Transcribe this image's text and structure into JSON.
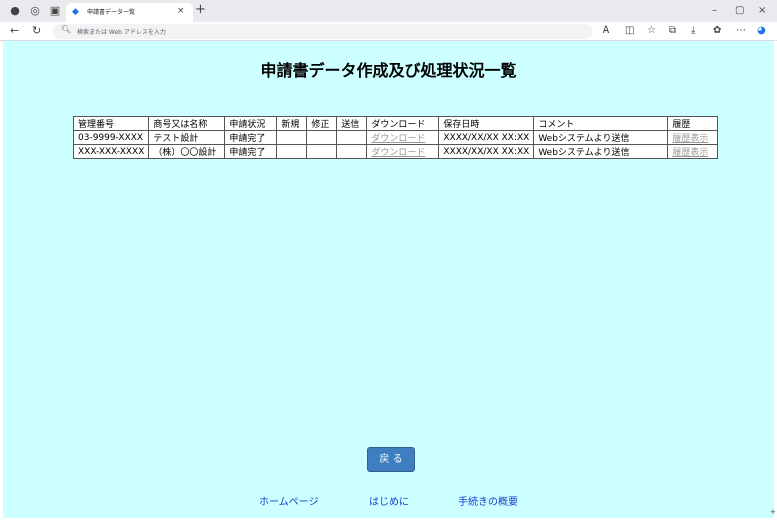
{
  "browser": {
    "tab_title": "申請書データ一覧",
    "tab_close": "×",
    "new_tab": "+",
    "address_placeholder": "検索または Web アドレスを入力",
    "window_controls": [
      "–",
      "▢",
      "×"
    ]
  },
  "page": {
    "title": "申請書データ作成及び処理状況一覧",
    "table": {
      "headers": [
        "管理番号",
        "商号又は名称",
        "申請状況",
        "新規",
        "修正",
        "送信",
        "ダウンロード",
        "保存日時",
        "コメント",
        "履歴"
      ],
      "rows": [
        {
          "id": "03-9999-XXXX",
          "name": "テスト設計",
          "status": "申請完了",
          "new": "",
          "edit": "",
          "send": "",
          "download": "ダウンロード",
          "saved": "XXXX/XX/XX XX:XX",
          "comment": "Webシステムより送信",
          "history": "履歴表示"
        },
        {
          "id": "XXX-XXX-XXXX",
          "name": "（株）〇〇設計",
          "status": "申請完了",
          "new": "",
          "edit": "",
          "send": "",
          "download": "ダウンロード",
          "saved": "XXXX/XX/XX XX:XX",
          "comment": "Webシステムより送信",
          "history": "履歴表示"
        }
      ]
    },
    "back_button": "戻 る",
    "footer_links": [
      "ホームページ",
      "はじめに",
      "手続きの概要"
    ]
  },
  "colors": {
    "page_bg": "#ccffff",
    "button": "#3f7fbf",
    "link": "#1a3ecf"
  }
}
